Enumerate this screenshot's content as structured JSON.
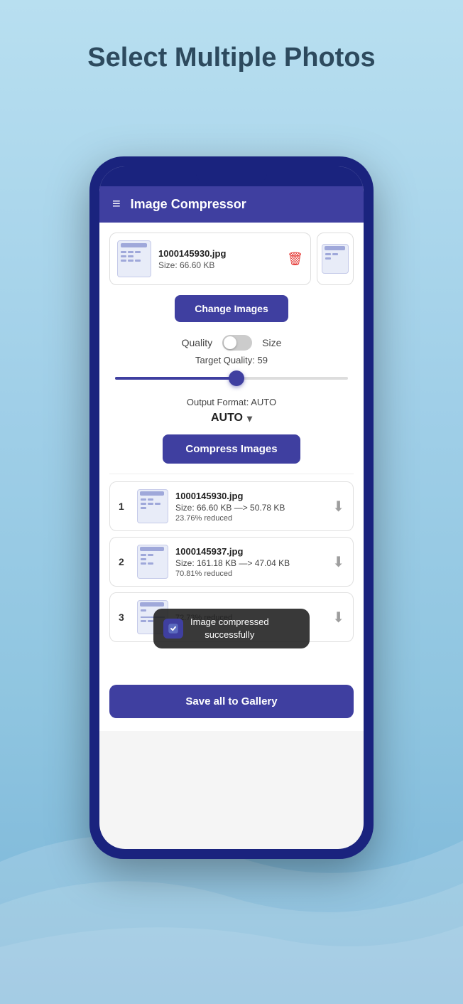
{
  "page": {
    "title": "Select Multiple Photos",
    "background_top": "#b8dff0",
    "background_bottom": "#7ab5d8"
  },
  "app": {
    "header_title": "Image Compressor",
    "hamburger_icon": "≡"
  },
  "image_card": {
    "filename": "1000145930.jpg",
    "size": "Size: 66.60 KB"
  },
  "buttons": {
    "change_images": "Change Images",
    "compress_images": "Compress Images",
    "save_all": "Save all to Gallery"
  },
  "quality_toggle": {
    "quality_label": "Quality",
    "size_label": "Size"
  },
  "slider": {
    "label": "Target Quality: 59",
    "value": 59,
    "fill_percent": 52
  },
  "output_format": {
    "label": "Output Format: AUTO",
    "selected": "AUTO"
  },
  "results": [
    {
      "num": "1",
      "filename": "1000145930.jpg",
      "size_info": "Size: 66.60 KB  —>  50.78 KB",
      "reduced": "23.76% reduced"
    },
    {
      "num": "2",
      "filename": "1000145937.jpg",
      "size_info": "Size: 161.18 KB  —>  47.04 KB",
      "reduced": "70.81% reduced"
    },
    {
      "num": "3",
      "filename": "",
      "size_info": "",
      "reduced": "72.73% reduced"
    }
  ],
  "toast": {
    "message": "Image compressed\nsuccessfully"
  },
  "icons": {
    "delete": "🗑",
    "download": "⬇",
    "chevron_down": "▾",
    "toast_app": "📦"
  }
}
